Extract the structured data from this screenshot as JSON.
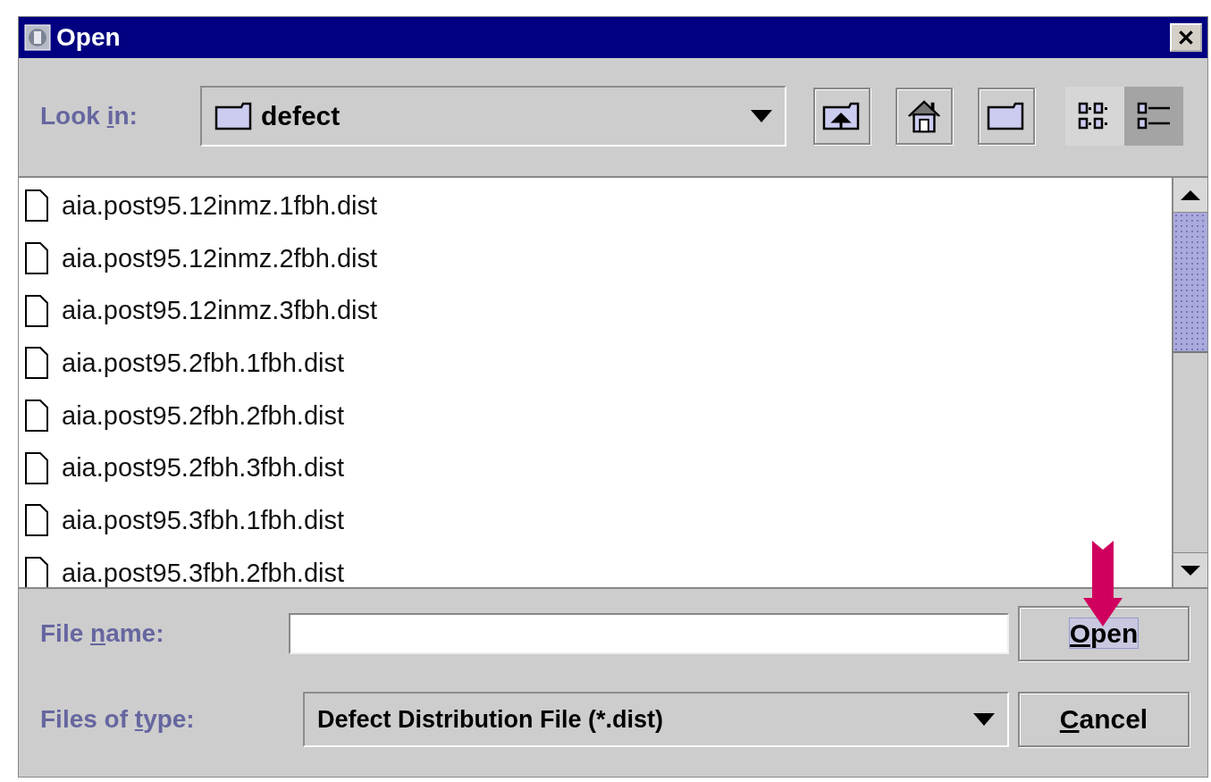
{
  "window": {
    "title": "Open"
  },
  "look_in": {
    "label": {
      "before": "Look ",
      "mnemonic": "i",
      "after": "n:"
    },
    "value": "defect"
  },
  "toolbar": {
    "buttons": [
      {
        "kind": "up"
      },
      {
        "kind": "home"
      },
      {
        "kind": "new-folder"
      }
    ],
    "views": [
      {
        "kind": "list",
        "selected": false
      },
      {
        "kind": "details",
        "selected": true
      }
    ]
  },
  "files": [
    "aia.post95.12inmz.1fbh.dist",
    "aia.post95.12inmz.2fbh.dist",
    "aia.post95.12inmz.3fbh.dist",
    "aia.post95.2fbh.1fbh.dist",
    "aia.post95.2fbh.2fbh.dist",
    "aia.post95.2fbh.3fbh.dist",
    "aia.post95.3fbh.1fbh.dist",
    "aia.post95.3fbh.2fbh.dist"
  ],
  "file_name": {
    "label": {
      "before": "File ",
      "mnemonic": "n",
      "after": "ame:"
    }
  },
  "file_type": {
    "label": {
      "before": "Files of ",
      "mnemonic": "t",
      "after": "ype:"
    },
    "value": "Defect Distribution File (*.dist)"
  },
  "buttons": [
    {
      "label": {
        "mnemonic": "O",
        "after": "pen"
      },
      "focused": true
    },
    {
      "label": {
        "mnemonic": "C",
        "after": "ancel"
      },
      "focused": false
    }
  ],
  "annotation": {
    "kind": "arrow",
    "color": "#d0005f"
  }
}
